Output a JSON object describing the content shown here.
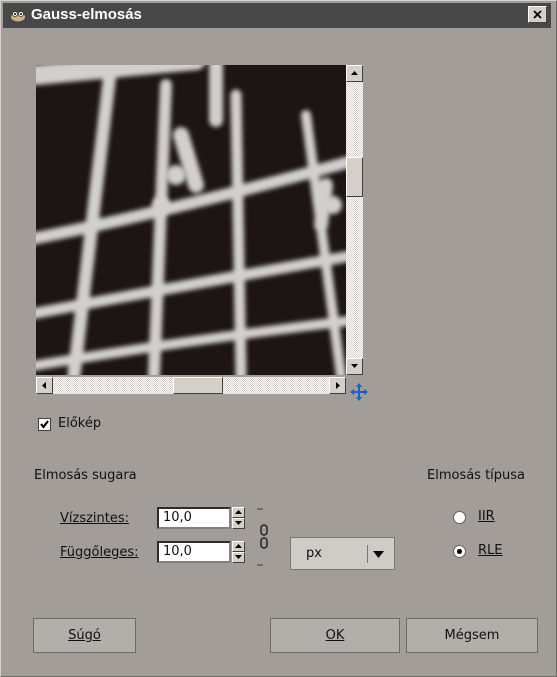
{
  "window": {
    "title": "Gauss-elmosás"
  },
  "preview": {
    "enabled_label": "Előkép",
    "enabled": true
  },
  "blur_radius": {
    "section_label": "Elmosás sugara",
    "horizontal_label": "Vízszintes:",
    "horizontal_value": "10,0",
    "vertical_label": "Függőleges:",
    "vertical_value": "10,0",
    "unit": "px"
  },
  "blur_method": {
    "section_label": "Elmosás típusa",
    "options": [
      "IIR",
      "RLE"
    ],
    "selected": "RLE"
  },
  "buttons": {
    "help": "Súgó",
    "ok": "OK",
    "cancel": "Mégsem"
  }
}
